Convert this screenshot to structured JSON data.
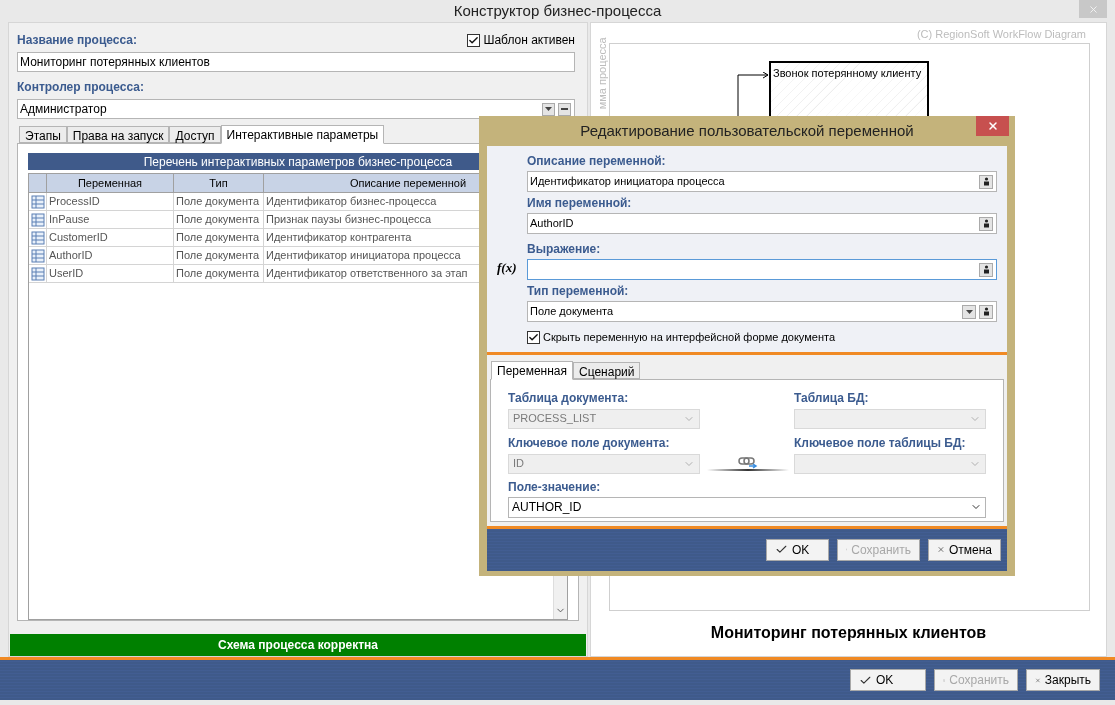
{
  "window": {
    "title": "Конструктор бизнес-процесса"
  },
  "process_name": {
    "label": "Название процесса:",
    "value": "Мониторинг потерянных клиентов"
  },
  "template_active": {
    "label": "Шаблон активен",
    "checked": true
  },
  "controller": {
    "label": "Контролер процесса:",
    "value": "Администратор"
  },
  "tabs": [
    {
      "label": "Этапы",
      "selected": false
    },
    {
      "label": "Права на запуск",
      "selected": false
    },
    {
      "label": "Доступ",
      "selected": false
    },
    {
      "label": "Интерактивные параметры",
      "selected": true
    }
  ],
  "params_table": {
    "title": "Перечень интерактивных параметров бизнес-процесса",
    "columns": [
      "Переменная",
      "Тип",
      "Описание переменной"
    ],
    "rows": [
      [
        "ProcessID",
        "Поле документа",
        "Идентификатор бизнес-процесса"
      ],
      [
        "InPause",
        "Поле документа",
        "Признак паузы бизнес-процесса"
      ],
      [
        "CustomerID",
        "Поле документа",
        "Идентификатор контрагента"
      ],
      [
        "AuthorID",
        "Поле документа",
        "Идентификатор инициатора процесса"
      ],
      [
        "UserID",
        "Поле документа",
        "Идентификатор ответственного за этап"
      ]
    ]
  },
  "status": "Схема процесса корректна",
  "diagram": {
    "watermark": "(C) RegionSoft WorkFlow Diagram",
    "side_label": "мма процесса",
    "node_label": "Звонок потерянному клиенту",
    "caption": "Мониторинг потерянных клиентов"
  },
  "buttons": [
    {
      "kind": "ok",
      "label": "OK",
      "disabled": false
    },
    {
      "kind": "save",
      "label": "Сохранить",
      "disabled": true
    },
    {
      "kind": "close",
      "label": "Закрыть",
      "disabled": false
    }
  ],
  "dialog": {
    "title": "Редактирование пользовательской переменной",
    "expression_icon": "f(x)",
    "fields": [
      {
        "kind": "text",
        "label": "Описание переменной:",
        "value": "Идентификатор инициатора процесса",
        "focused": false
      },
      {
        "kind": "text",
        "label": "Имя переменной:",
        "value": "AuthorID",
        "focused": false
      },
      {
        "kind": "expression",
        "label": "Выражение:",
        "focused": true
      },
      {
        "kind": "select",
        "label": "Тип переменной:",
        "value": "Поле документа",
        "focused": false
      }
    ],
    "hide_checkbox": {
      "label": "Скрыть переменную на интерфейсной форме документа",
      "checked": true
    },
    "tabs": [
      {
        "label": "Переменная",
        "selected": true
      },
      {
        "label": "Сценарий",
        "selected": false
      }
    ],
    "doc_table": {
      "label": "Таблица документа:",
      "value": "PROCESS_LIST",
      "disabled": true
    },
    "db_table": {
      "label": "Таблица БД:",
      "disabled": true
    },
    "doc_key": {
      "label": "Ключевое поле документа:",
      "value": "ID",
      "disabled": true
    },
    "db_key": {
      "label": "Ключевое поле таблицы БД:",
      "disabled": true
    },
    "value_field": {
      "label": "Поле-значение:",
      "value": "AUTHOR_ID",
      "disabled": false
    },
    "buttons": [
      {
        "kind": "ok",
        "label": "OK",
        "disabled": false
      },
      {
        "kind": "save",
        "label": "Сохранить",
        "disabled": true
      },
      {
        "kind": "cancel",
        "label": "Отмена",
        "disabled": false
      }
    ]
  }
}
